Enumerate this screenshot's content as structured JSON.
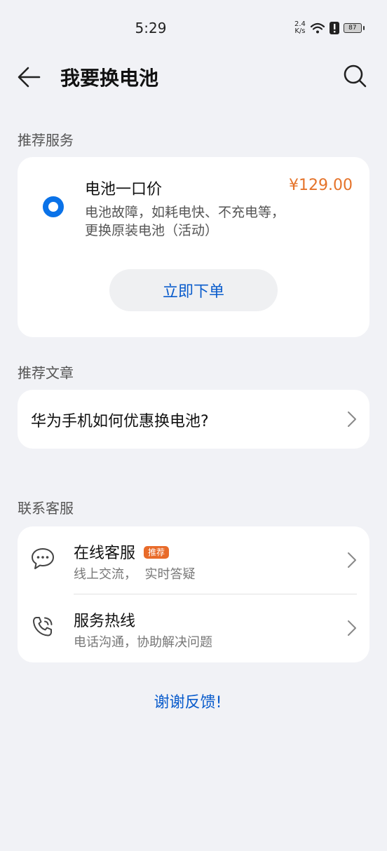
{
  "status": {
    "time": "5:29",
    "net_speed_value": "2.4",
    "net_speed_unit": "K/s",
    "battery": "87"
  },
  "header": {
    "title": "我要换电池"
  },
  "recommended_service": {
    "section_label": "推荐服务",
    "name": "电池一口价",
    "price": "¥129.00",
    "description": "电池故障，如耗电快、不充电等，更换原装电池（活动）",
    "order_label": "立即下单"
  },
  "recommended_article": {
    "section_label": "推荐文章",
    "title": "华为手机如何优惠换电池?"
  },
  "contact": {
    "section_label": "联系客服",
    "items": [
      {
        "title": "在线客服",
        "badge": "推荐",
        "subtitle": "线上交流，  实时答疑",
        "icon": "chat-bubble-icon"
      },
      {
        "title": "服务热线",
        "subtitle": "电话沟通，协助解决问题",
        "icon": "phone-icon"
      }
    ]
  },
  "feedback_label": "谢谢反馈!",
  "colors": {
    "accent_blue": "#0a72e8",
    "price_orange": "#e5732a",
    "background": "#f1f2f6"
  }
}
